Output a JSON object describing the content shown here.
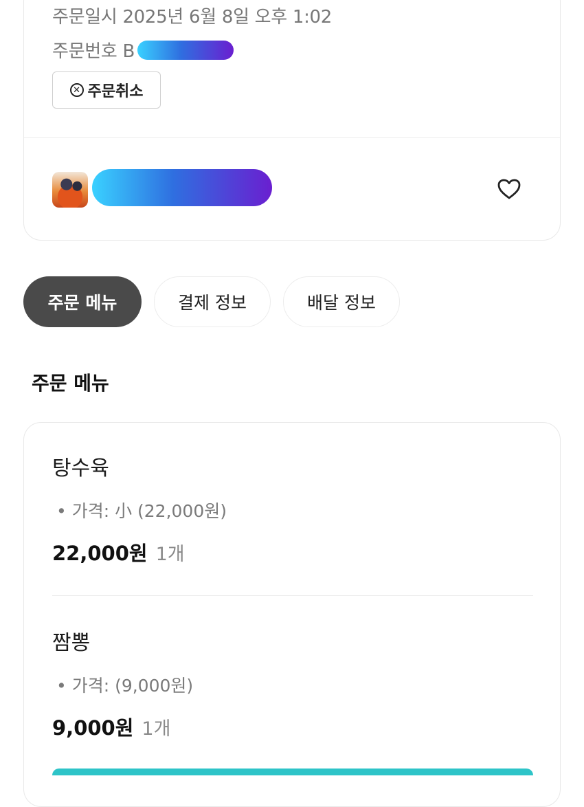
{
  "order": {
    "date_text": "주문일시 2025년 6월 8일 오후 1:02",
    "number_label": "주문번호 B",
    "cancel_label": "주문취소"
  },
  "store": {
    "thumbnail_icon": "food-thumbnail",
    "favorite_icon": "heart-outline-icon"
  },
  "tabs": [
    {
      "label": "주문 메뉴",
      "active": true
    },
    {
      "label": "결제 정보",
      "active": false
    },
    {
      "label": "배달 정보",
      "active": false
    }
  ],
  "menu_section": {
    "title": "주문 메뉴",
    "items": [
      {
        "name": "탕수육",
        "option": "• 가격: 小 (22,000원)",
        "price": "22,000원",
        "quantity": "1개"
      },
      {
        "name": "짬뽕",
        "option": "• 가격: (9,000원)",
        "price": "9,000원",
        "quantity": "1개"
      }
    ]
  },
  "colors": {
    "active_tab_bg": "#4a4a4a",
    "cta_accent": "#2ec4c8",
    "redaction_gradient_start": "#3ad1ff",
    "redaction_gradient_end": "#6a1fd0"
  }
}
